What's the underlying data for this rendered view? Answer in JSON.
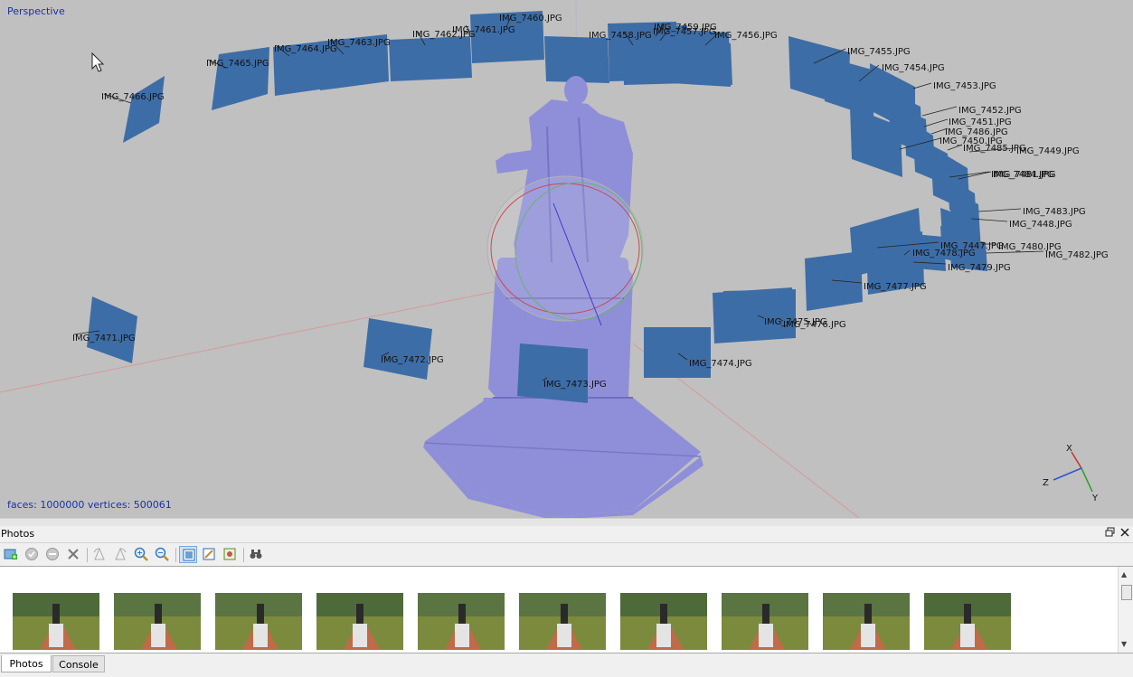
{
  "viewport": {
    "view_mode": "Perspective",
    "stats": "faces: 1000000 vertices: 500061",
    "axes": {
      "x": "X",
      "y": "Y",
      "z": "Z"
    },
    "camera_color": "#3d6da6",
    "mesh_color": "#8f8fd9",
    "background_color": "#c0c0c0",
    "camera_labels": [
      "IMG_7460.JPG",
      "IMG_7459.JPG",
      "IMG_7457.JPG",
      "IMG_7458.JPG",
      "IMG_7456.JPG",
      "IMG_7461.JPG",
      "IMG_7462.JPG",
      "IMG_7463.JPG",
      "IMG_7464.JPG",
      "IMG_7465.JPG",
      "IMG_7466.JPG",
      "IMG_7455.JPG",
      "IMG_7454.JPG",
      "IMG_7453.JPG",
      "IMG_7452.JPG",
      "IMG_7451.JPG",
      "IMG_7486.JPG",
      "IMG_7450.JPG",
      "IMG_7485.JPG",
      "IMG_7449.JPG",
      "IMG_7484.JPG",
      "IMG_7481.JPG",
      "IMG_7483.JPG",
      "IMG_7448.JPG",
      "IMG_7447.JPG",
      "IMG_7480.JPG",
      "IMG_7478.JPG",
      "IMG_7482.JPG",
      "IMG_7479.JPG",
      "IMG_7477.JPG",
      "IMG_7475.JPG",
      "IMG_7476.JPG",
      "IMG_7474.JPG",
      "IMG_7473.JPG",
      "IMG_7472.JPG",
      "IMG_7471.JPG"
    ]
  },
  "photos_panel": {
    "title": "Photos",
    "restore_icon": "restore-icon",
    "close_icon": "close-icon",
    "toolbar": [
      "add-photos-icon",
      "enable-icon",
      "disable-icon",
      "remove-icon",
      "rotate-left-icon",
      "rotate-right-icon",
      "zoom-in-icon",
      "zoom-out-icon",
      "large-icons-icon",
      "medium-icons-icon",
      "details-icon",
      "binoculars-icon"
    ],
    "thumbnail_count": 10
  },
  "tabs": [
    {
      "label": "Photos",
      "active": true
    },
    {
      "label": "Console",
      "active": false
    }
  ]
}
